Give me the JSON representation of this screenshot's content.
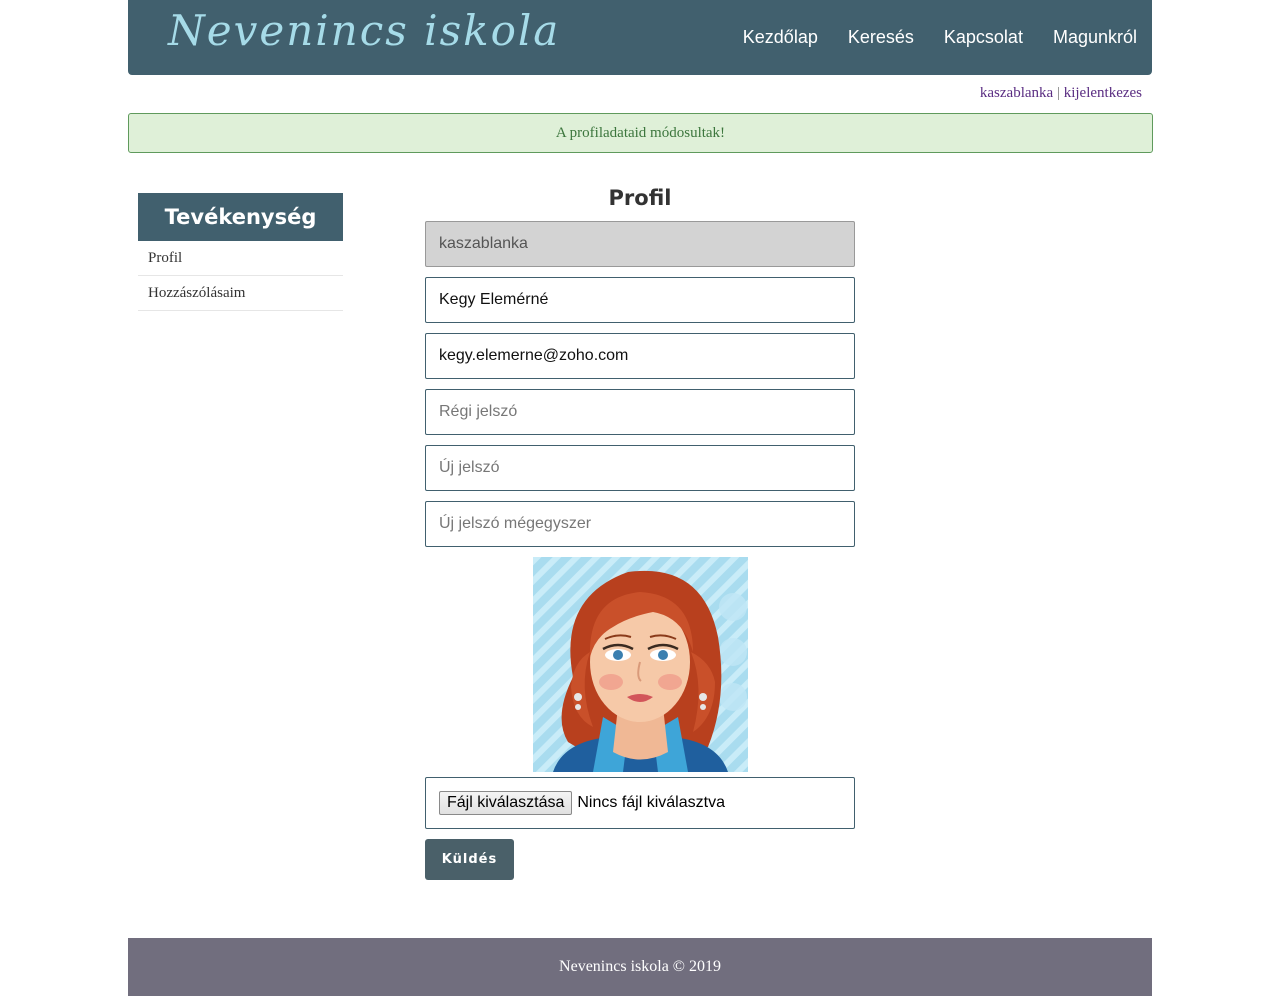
{
  "header": {
    "logo": "Nevenincs iskola",
    "nav": [
      "Kezdőlap",
      "Keresés",
      "Kapcsolat",
      "Magunkról"
    ]
  },
  "userbar": {
    "username": "kaszablanka",
    "separator": "|",
    "logout": "kijelentkezes"
  },
  "alert": {
    "message": "A profiladataid módosultak!"
  },
  "sidebar": {
    "title": "Tevékenység",
    "items": [
      {
        "label": "Profil"
      },
      {
        "label": "Hozzászólásaim"
      }
    ]
  },
  "profile_form": {
    "title": "Profil",
    "username_value": "kaszablanka",
    "name_value": "Kegy Elemérné",
    "email_value": "kegy.elemerne@zoho.com",
    "old_password_placeholder": "Régi jelszó",
    "new_password_placeholder": "Új jelszó",
    "confirm_password_placeholder": "Új jelszó mégegyszer",
    "file_button_label": "Fájl kiválasztása",
    "file_status": "Nincs fájl kiválasztva",
    "submit_label": "Küldés"
  },
  "footer": {
    "text": "Nevenincs iskola © 2019"
  },
  "colors": {
    "header_bg": "#41606e",
    "logo": "#a6dbe8",
    "alert_bg": "#dff0d8",
    "alert_text": "#3c763d",
    "footer_bg": "#716e7e",
    "submit_bg": "#4a6069",
    "link": "#5a2d82"
  }
}
